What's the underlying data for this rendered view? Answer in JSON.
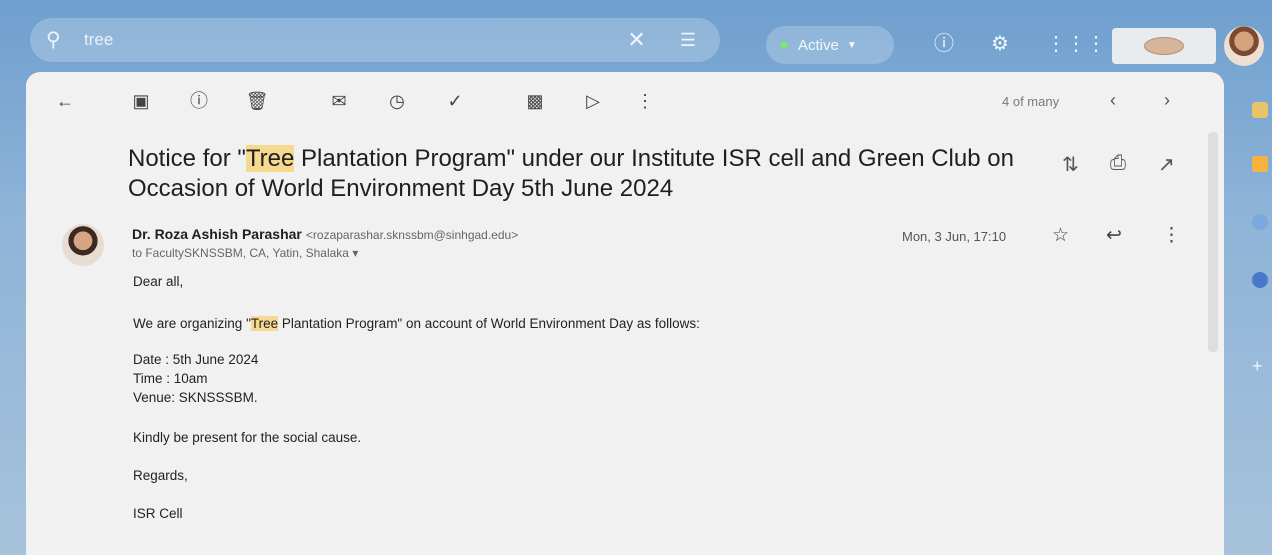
{
  "search": {
    "query": "tree"
  },
  "status": {
    "label": "Active"
  },
  "toolbar": {
    "counter": "4 of many"
  },
  "email": {
    "subject_pre": "Notice for \"",
    "subject_hl": "Tree",
    "subject_post": " Plantation Program\" under our Institute ISR cell and Green Club on Occasion of World Environment Day 5th June 2024",
    "sender_name": "Dr. Roza Ashish Parashar",
    "sender_email": "<rozaparashar.sknssbm@sinhgad.edu>",
    "recipients": "to FacultySKNSSBM, CA, Yatin, Shalaka",
    "date": "Mon, 3 Jun, 17:10",
    "body": {
      "greeting": "Dear all,",
      "intro_pre": "We are organizing \"",
      "intro_hl": "Tree",
      "intro_post": " Plantation Program\" on account of World Environment Day as follows:",
      "date_line": "Date : 5th June 2024",
      "time_line": "Time : 10am",
      "venue_line": "Venue: SKNSSSBM.",
      "request": "Kindly be present for the social cause.",
      "closing": "Regards,",
      "signature": "ISR Cell"
    }
  },
  "icons": {
    "search": "search-icon",
    "clear": "close-icon",
    "filter": "tune-icon",
    "help": "help-icon",
    "settings": "gear-icon",
    "apps": "apps-grid-icon",
    "back": "arrow-left-icon",
    "archive": "archive-icon",
    "spam": "report-spam-icon",
    "delete": "trash-icon",
    "unread": "mark-unread-icon",
    "snooze": "clock-icon",
    "task": "add-task-icon",
    "move": "move-to-icon",
    "label": "label-icon",
    "more": "more-vert-icon",
    "prev": "chevron-left-icon",
    "next": "chevron-right-icon",
    "collapse": "collapse-icon",
    "print": "print-icon",
    "newwin": "open-in-new-icon",
    "star": "star-icon",
    "reply": "reply-icon"
  },
  "colors": {
    "highlight": "#f4d98f",
    "panel": "#f1f1f1",
    "active_dot": "#7fe08a"
  }
}
